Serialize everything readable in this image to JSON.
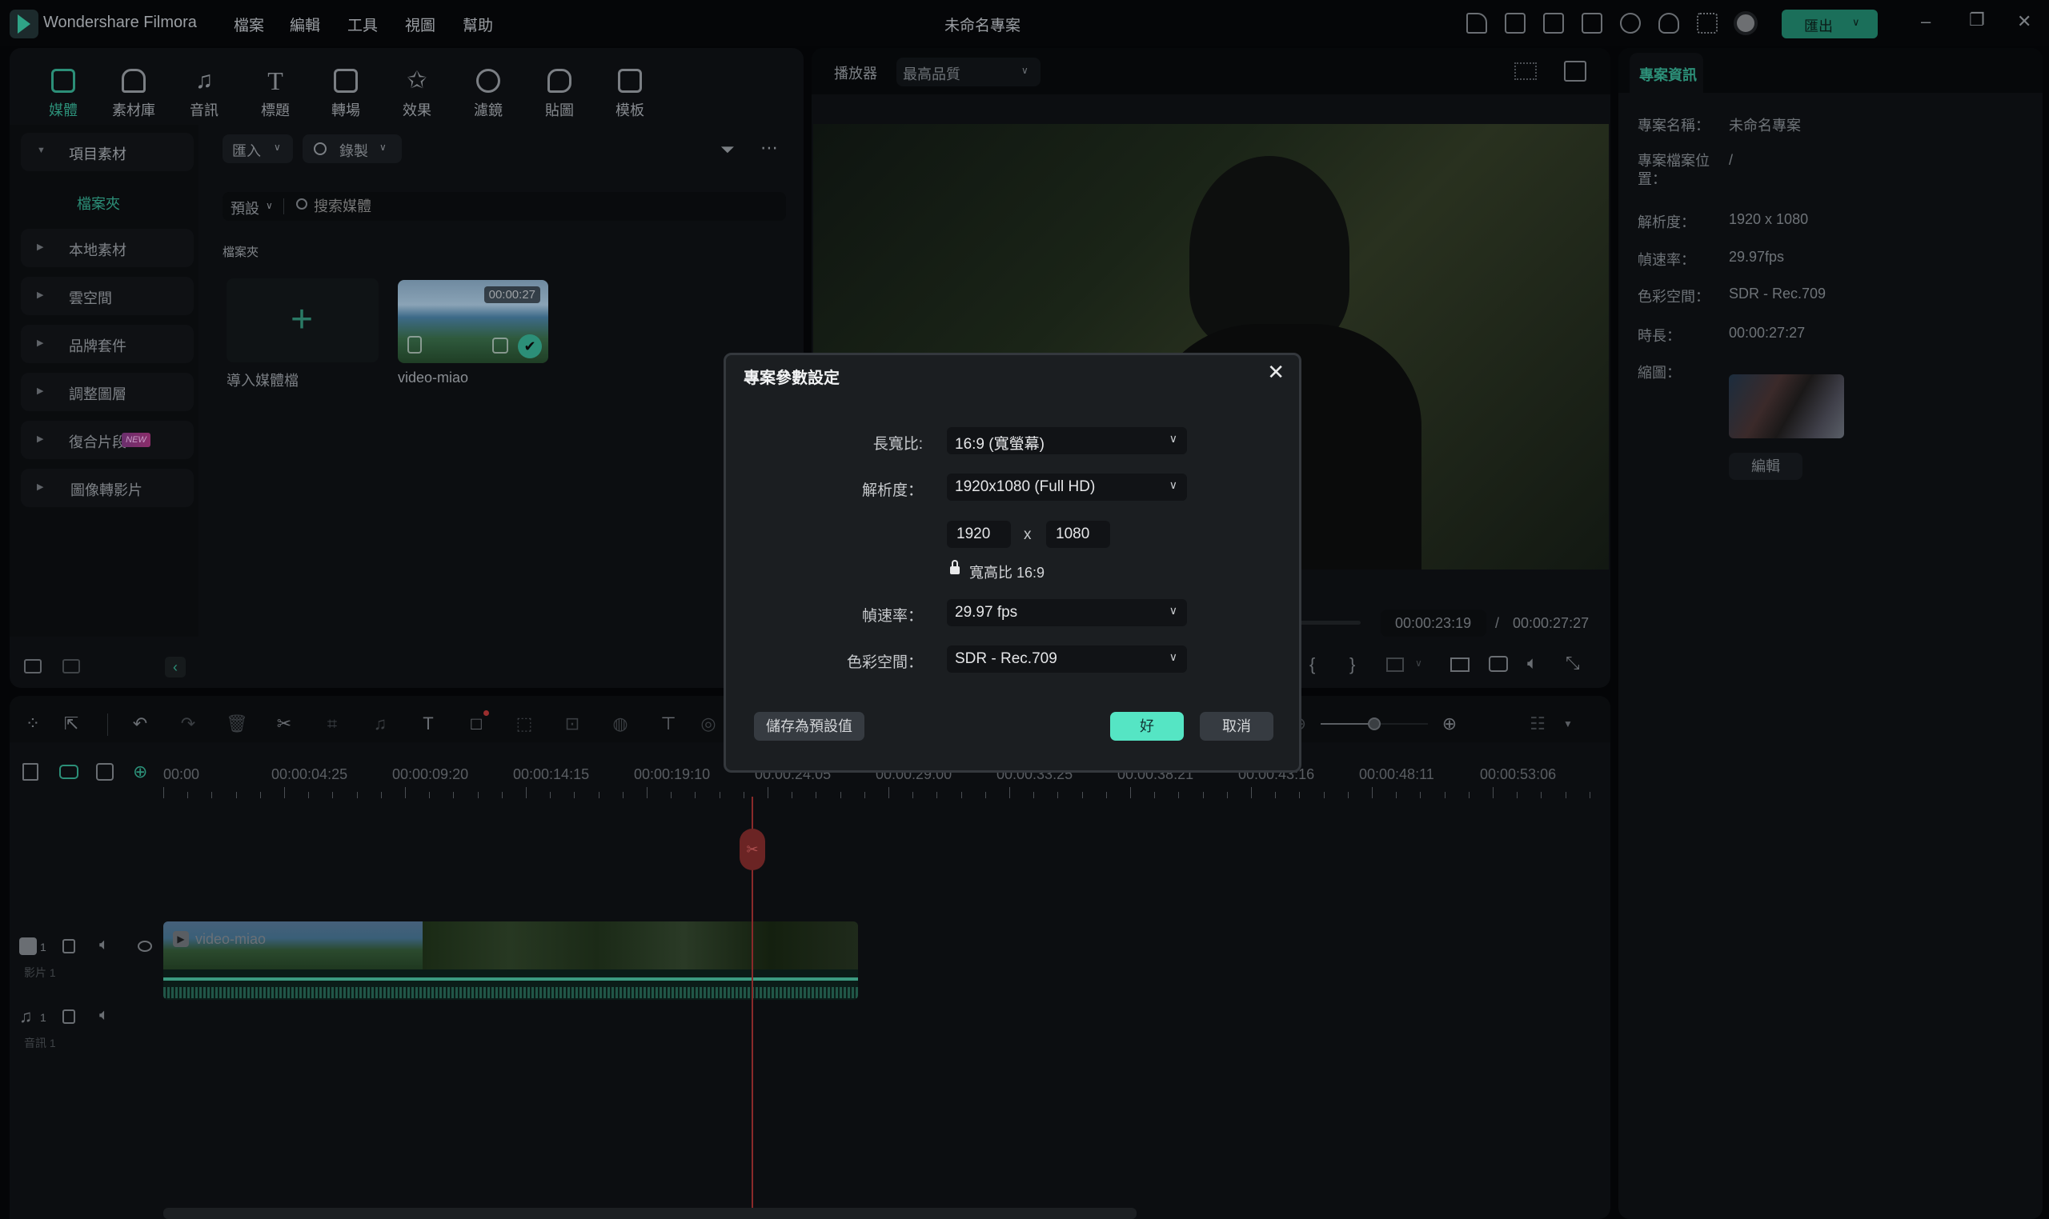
{
  "app": {
    "name": "Wondershare Filmora",
    "project_title": "未命名專案",
    "export_label": "匯出"
  },
  "menu": [
    "檔案",
    "編輯",
    "工具",
    "視圖",
    "幫助"
  ],
  "toolbar_icons": [
    "send-icon",
    "schedule-icon",
    "layout-icon",
    "save-icon",
    "cloud-icon",
    "headset-icon",
    "grid-apps-icon",
    "avatar"
  ],
  "media_tabs": [
    {
      "label": "媒體",
      "icon": "media-icon",
      "active": true
    },
    {
      "label": "素材庫",
      "icon": "stock-icon",
      "active": false
    },
    {
      "label": "音訊",
      "icon": "audio-icon",
      "active": false
    },
    {
      "label": "標題",
      "icon": "title-icon",
      "active": false
    },
    {
      "label": "轉場",
      "icon": "transition-icon",
      "active": false
    },
    {
      "label": "效果",
      "icon": "effects-icon",
      "active": false
    },
    {
      "label": "濾鏡",
      "icon": "filter-icon",
      "active": false
    },
    {
      "label": "貼圖",
      "icon": "sticker-icon",
      "active": false
    },
    {
      "label": "模板",
      "icon": "template-icon",
      "active": false
    }
  ],
  "sidebar": {
    "items": [
      {
        "label": "項目素材",
        "expanded": true
      },
      {
        "label": "檔案夾",
        "sub": true,
        "active": true
      },
      {
        "label": "本地素材"
      },
      {
        "label": "雲空間"
      },
      {
        "label": "品牌套件"
      },
      {
        "label": "調整圖層"
      },
      {
        "label": "復合片段",
        "badge": "NEW"
      },
      {
        "label": "圖像轉影片"
      }
    ]
  },
  "media": {
    "import_label": "匯入",
    "record_label": "錄製",
    "sort_label": "預設",
    "search_placeholder": "搜索媒體",
    "folder_label": "檔案夾",
    "items": [
      {
        "label": "導入媒體檔",
        "type": "import"
      },
      {
        "label": "video-miao",
        "duration": "00:00:27",
        "type": "video"
      }
    ]
  },
  "player": {
    "label": "播放器",
    "quality": "最高品質",
    "current_time": "00:00:23:19",
    "separator": "/",
    "total_time": "00:00:27:27"
  },
  "project_info": {
    "tab": "專案資訊",
    "rows": [
      {
        "label": "專案名稱：",
        "value": "未命名專案"
      },
      {
        "label": "專案檔案位置：",
        "value": "/"
      },
      {
        "label": "解析度：",
        "value": "1920 x 1080"
      },
      {
        "label": "幀速率：",
        "value": "29.97fps"
      },
      {
        "label": "色彩空間：",
        "value": "SDR - Rec.709"
      },
      {
        "label": "時長：",
        "value": "00:00:27:27"
      },
      {
        "label": "縮圖：",
        "value": ""
      }
    ],
    "edit_label": "編輯"
  },
  "timeline": {
    "ruler": [
      "00:00",
      "00:00:04:25",
      "00:00:09:20",
      "00:00:14:15",
      "00:00:19:10",
      "00:00:24:05",
      "00:00:29:00",
      "00:00:33:25",
      "00:00:38:21",
      "00:00:43:16",
      "00:00:48:11",
      "00:00:53:06"
    ],
    "playhead_time": "00:00:23:19",
    "zoom_level": 0.5,
    "tracks": [
      {
        "type": "video",
        "index": "1",
        "name": "影片 1",
        "clip": "video-miao"
      },
      {
        "type": "audio",
        "index": "1",
        "name": "音訊 1"
      }
    ]
  },
  "dialog": {
    "title": "專案參數設定",
    "aspect_label": "長寬比:",
    "aspect_value": "16:9 (寬螢幕)",
    "resolution_label": "解析度：",
    "resolution_value": "1920x1080 (Full HD)",
    "width_value": "1920",
    "times": "x",
    "height_value": "1080",
    "lock_label": "寬高比 16:9",
    "framerate_label": "幀速率：",
    "framerate_value": "29.97 fps",
    "colorspace_label": "色彩空間：",
    "colorspace_value": "SDR - Rec.709",
    "save_preset_label": "儲存為預設值",
    "ok_label": "好",
    "cancel_label": "取消"
  },
  "colors": {
    "accent": "#2c8f78",
    "ok_button": "#55e5c4",
    "playhead": "#8a2a2a",
    "export": "#1b6f5a"
  }
}
